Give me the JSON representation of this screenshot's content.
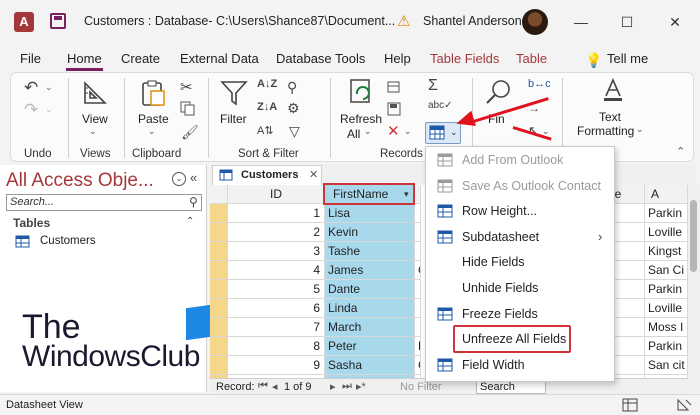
{
  "title_bar": {
    "app_logo": "A",
    "window_title": "Customers : Database- C:\\Users\\Shance87\\Document...",
    "user_name": "Shantel Anderson",
    "minimize": "—",
    "maximize": "☐",
    "close": "✕"
  },
  "menu": {
    "tabs": [
      "File",
      "Home",
      "Create",
      "External Data",
      "Database Tools",
      "Help",
      "Table Fields",
      "Table"
    ],
    "active_tab": "Home",
    "tell_me": "Tell me"
  },
  "ribbon": {
    "groups": {
      "undo": "Undo",
      "views": "Views",
      "clipboard": "Clipboard",
      "sort_filter": "Sort & Filter",
      "records": "Records"
    },
    "view_label": "View",
    "paste_label": "Paste",
    "filter_label": "Filter",
    "refresh_label": "Refresh",
    "refresh_all": "All",
    "find_label": "Fin",
    "text_label": "Text",
    "formatting_label": "Formatting"
  },
  "nav": {
    "title": "All Access Obje...",
    "search_placeholder": "Search...",
    "tables_header": "Tables",
    "items": [
      "Customers"
    ]
  },
  "datasheet": {
    "tab": "Customers",
    "columns": [
      "ID",
      "FirstName",
      "",
      "be",
      "A"
    ],
    "rows": [
      {
        "id": "1",
        "first": "Lisa",
        "c": "",
        "d": "",
        "a": "Parkin"
      },
      {
        "id": "2",
        "first": "Kevin",
        "c": "",
        "d": "",
        "a": "Loville"
      },
      {
        "id": "3",
        "first": "Tashe",
        "c": "",
        "d": "",
        "a": "Kingst"
      },
      {
        "id": "4",
        "first": "James",
        "c": "C",
        "d": "",
        "a": "San Ci"
      },
      {
        "id": "5",
        "first": "Dante",
        "c": "",
        "d": "",
        "a": "Parkin"
      },
      {
        "id": "6",
        "first": "Linda",
        "c": "",
        "d": "",
        "a": "Loville"
      },
      {
        "id": "7",
        "first": "March",
        "c": "",
        "d": "",
        "a": "Moss I"
      },
      {
        "id": "8",
        "first": "Peter",
        "c": "F",
        "d": "",
        "a": "Parkin"
      },
      {
        "id": "9",
        "first": "Sasha",
        "c": "C",
        "d": "",
        "a": "San cit"
      },
      {
        "id": "",
        "first": "",
        "c": "",
        "d": "",
        "a": ""
      }
    ],
    "record_label": "Record:",
    "record_pos": "1 of 9",
    "no_filter": "No Filter",
    "search": "Search"
  },
  "context_menu": {
    "items": [
      {
        "label": "Add From Outlook",
        "disabled": true,
        "icon": "outlook-icon"
      },
      {
        "label": "Save As Outlook Contact",
        "disabled": true,
        "icon": "contact-icon"
      },
      {
        "label": "Row Height...",
        "disabled": false,
        "icon": "row-height-icon"
      },
      {
        "label": "Subdatasheet",
        "disabled": false,
        "icon": "subdatasheet-icon",
        "submenu": true
      },
      {
        "label": "Hide Fields",
        "disabled": false,
        "icon": ""
      },
      {
        "label": "Unhide Fields",
        "disabled": false,
        "icon": ""
      },
      {
        "label": "Freeze Fields",
        "disabled": false,
        "icon": "freeze-icon"
      },
      {
        "label": "Unfreeze All Fields",
        "disabled": false,
        "icon": ""
      },
      {
        "label": "Field Width",
        "disabled": false,
        "icon": "field-width-icon"
      }
    ]
  },
  "statusbar": {
    "left": "Datasheet View"
  },
  "watermark": {
    "line1": "The",
    "line2": "WindowsClub"
  },
  "colors": {
    "accent": "#a4373a",
    "highlight": "#d13438",
    "selected_column": "#a8d8ec",
    "arrow": "#e0121c"
  }
}
